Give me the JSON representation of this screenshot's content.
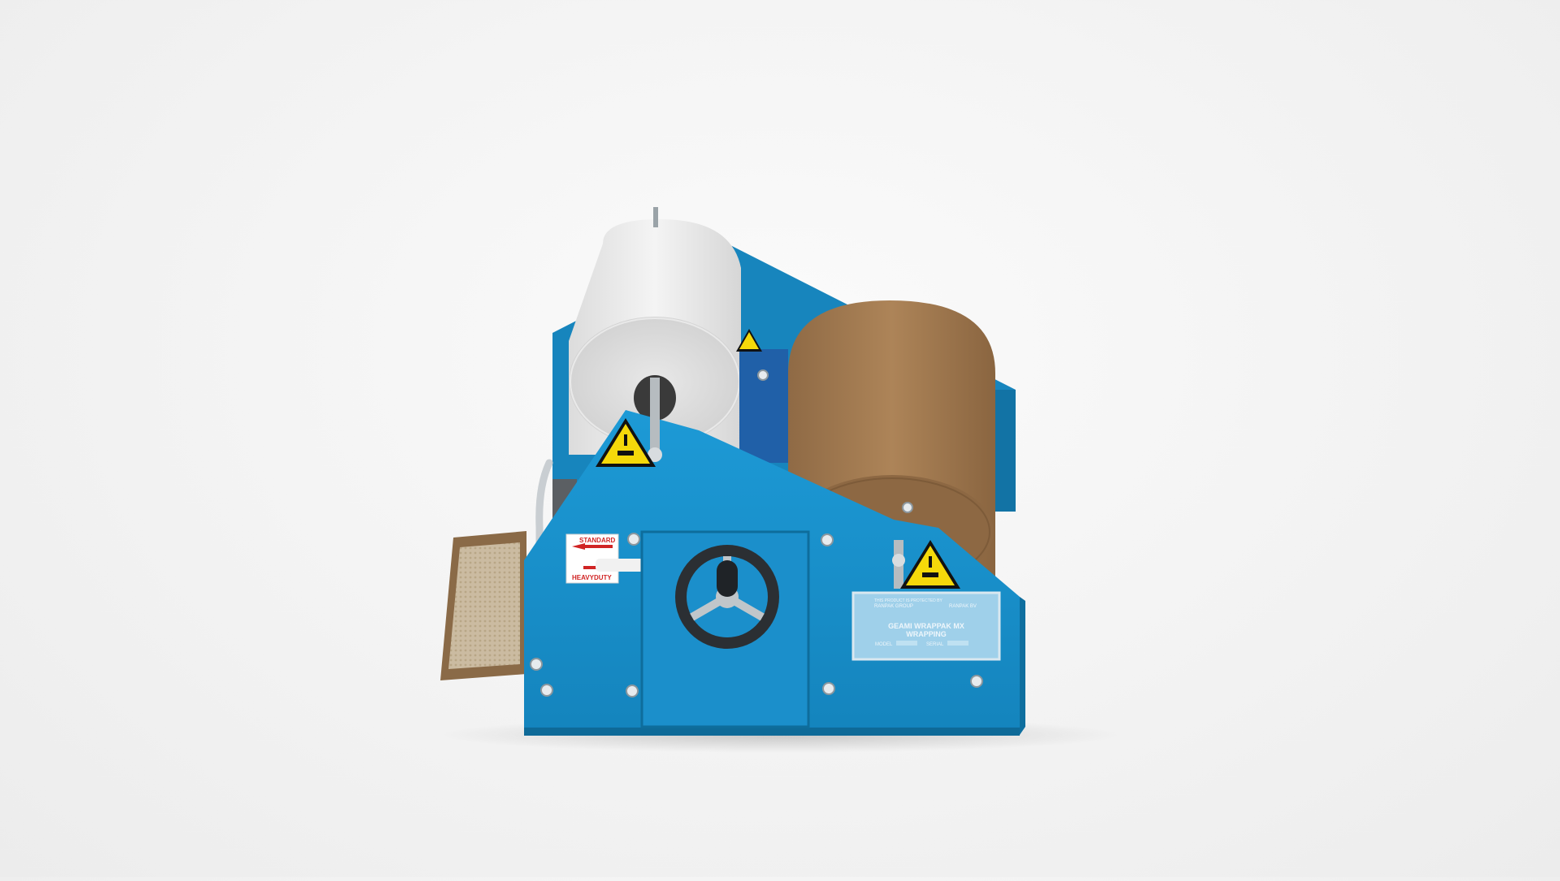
{
  "scene": {
    "subject": "paper wrapping dispenser machine",
    "labels": {
      "direction_top": "STANDARD",
      "direction_bottom": "HEAVYDUTY",
      "plate_line1": "THIS PRODUCT IS PROTECTED BY",
      "plate_maker": "RANPAK GROUP",
      "plate_tag": "RANPAK BV",
      "plate_title1": "GEAMI WRAPPAK MX",
      "plate_title2": "WRAPPING",
      "plate_model_label": "MODEL",
      "plate_serial_label": "SERIAL"
    },
    "colors": {
      "frame_blue": "#1a93cf",
      "frame_blue_dark": "#0f6f9f",
      "kraft_roll": "#a67c52",
      "tissue_roll": "#f3f3f3",
      "warning_yellow": "#f5d90a",
      "handwheel": "#2b2f33"
    },
    "icons": [
      "crush-hazard-warning-icon",
      "handwheel-icon"
    ]
  }
}
